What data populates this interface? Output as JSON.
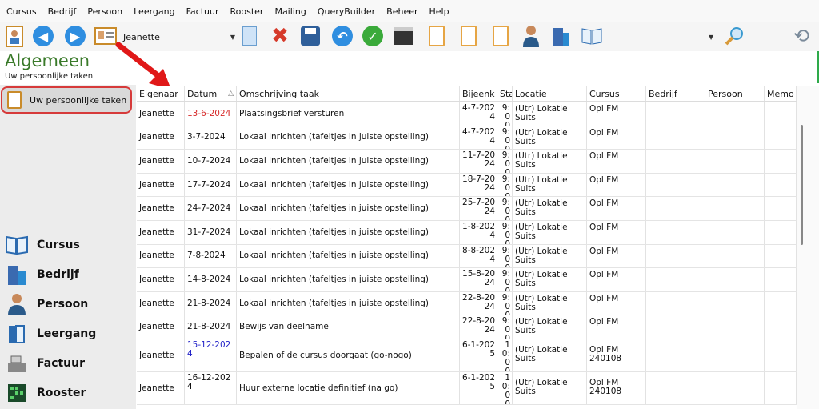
{
  "menu": [
    "Cursus",
    "Bedrijf",
    "Persoon",
    "Leergang",
    "Factuur",
    "Rooster",
    "Mailing",
    "QueryBuilder",
    "Beheer",
    "Help"
  ],
  "toolbar": {
    "user_select": "Jeanette",
    "icons": [
      "person-icon",
      "back-icon",
      "forward-icon",
      "card-icon",
      "new-doc-icon",
      "delete-icon",
      "save-icon",
      "undo-icon",
      "check-icon",
      "clapper-icon",
      "clipboard-check-icon",
      "clipboard-icon",
      "clipboard-edit-icon",
      "person-icon",
      "building-icon",
      "book-icon",
      "search-icon",
      "refresh-icon"
    ]
  },
  "page": {
    "title": "Algemeen",
    "subtitle": "Uw persoonlijke taken"
  },
  "sidebar": {
    "active": "Uw persoonlijke taken",
    "modules": [
      "Cursus",
      "Bedrijf",
      "Persoon",
      "Leergang",
      "Factuur",
      "Rooster"
    ]
  },
  "grid": {
    "headers": [
      "Eigenaar",
      "Datum",
      "Omschrijving taak",
      "Bijeenk",
      "Sta",
      "Locatie",
      "Cursus",
      "Bedrijf",
      "Persoon",
      "Memo"
    ],
    "sort_indicator": "△",
    "rows": [
      {
        "eigenaar": "Jeanette",
        "datum": "13-6-2024",
        "datum_color": "red",
        "taak": "Plaatsingsbrief versturen",
        "bijeenk": "4-7-2024",
        "sta": "9:00",
        "locatie": "(Utr) Lokatie Suits",
        "cursus": "Opl FM"
      },
      {
        "eigenaar": "Jeanette",
        "datum": "3-7-2024",
        "taak": "Lokaal inrichten (tafeltjes in juiste opstelling)",
        "bijeenk": "4-7-2024",
        "sta": "9:00",
        "locatie": "(Utr) Lokatie Suits",
        "cursus": "Opl FM"
      },
      {
        "eigenaar": "Jeanette",
        "datum": "10-7-2024",
        "taak": "Lokaal inrichten (tafeltjes in juiste opstelling)",
        "bijeenk": "11-7-2024",
        "sta": "9:00",
        "locatie": "(Utr) Lokatie Suits",
        "cursus": "Opl FM"
      },
      {
        "eigenaar": "Jeanette",
        "datum": "17-7-2024",
        "taak": "Lokaal inrichten (tafeltjes in juiste opstelling)",
        "bijeenk": "18-7-2024",
        "sta": "9:00",
        "locatie": "(Utr) Lokatie Suits",
        "cursus": "Opl FM"
      },
      {
        "eigenaar": "Jeanette",
        "datum": "24-7-2024",
        "taak": "Lokaal inrichten (tafeltjes in juiste opstelling)",
        "bijeenk": "25-7-2024",
        "sta": "9:00",
        "locatie": "(Utr) Lokatie Suits",
        "cursus": "Opl FM"
      },
      {
        "eigenaar": "Jeanette",
        "datum": "31-7-2024",
        "taak": "Lokaal inrichten (tafeltjes in juiste opstelling)",
        "bijeenk": "1-8-2024",
        "sta": "9:00",
        "locatie": "(Utr) Lokatie Suits",
        "cursus": "Opl FM"
      },
      {
        "eigenaar": "Jeanette",
        "datum": "7-8-2024",
        "taak": "Lokaal inrichten (tafeltjes in juiste opstelling)",
        "bijeenk": "8-8-2024",
        "sta": "9:00",
        "locatie": "(Utr) Lokatie Suits",
        "cursus": "Opl FM"
      },
      {
        "eigenaar": "Jeanette",
        "datum": "14-8-2024",
        "taak": "Lokaal inrichten (tafeltjes in juiste opstelling)",
        "bijeenk": "15-8-2024",
        "sta": "9:00",
        "locatie": "(Utr) Lokatie Suits",
        "cursus": "Opl FM"
      },
      {
        "eigenaar": "Jeanette",
        "datum": "21-8-2024",
        "taak": "Lokaal inrichten (tafeltjes in juiste opstelling)",
        "bijeenk": "22-8-2024",
        "sta": "9:00",
        "locatie": "(Utr) Lokatie Suits",
        "cursus": "Opl FM"
      },
      {
        "eigenaar": "Jeanette",
        "datum": "21-8-2024",
        "taak": "Bewijs van deelname",
        "bijeenk": "22-8-2024",
        "sta": "9:00",
        "locatie": "(Utr) Lokatie Suits",
        "cursus": "Opl FM"
      },
      {
        "eigenaar": "Jeanette",
        "datum": "15-12-2024",
        "datum_color": "blue",
        "taak": "Bepalen of de cursus doorgaat (go-nogo)",
        "bijeenk": "6-1-2025",
        "sta": "10:00",
        "locatie": "(Utr) Lokatie Suits",
        "cursus": "Opl FM 240108"
      },
      {
        "eigenaar": "Jeanette",
        "datum": "16-12-2024",
        "taak": "Huur externe locatie definitief (na go)",
        "bijeenk": "6-1-2025",
        "sta": "10:00",
        "locatie": "(Utr) Lokatie Suits",
        "cursus": "Opl FM 240108"
      }
    ]
  }
}
